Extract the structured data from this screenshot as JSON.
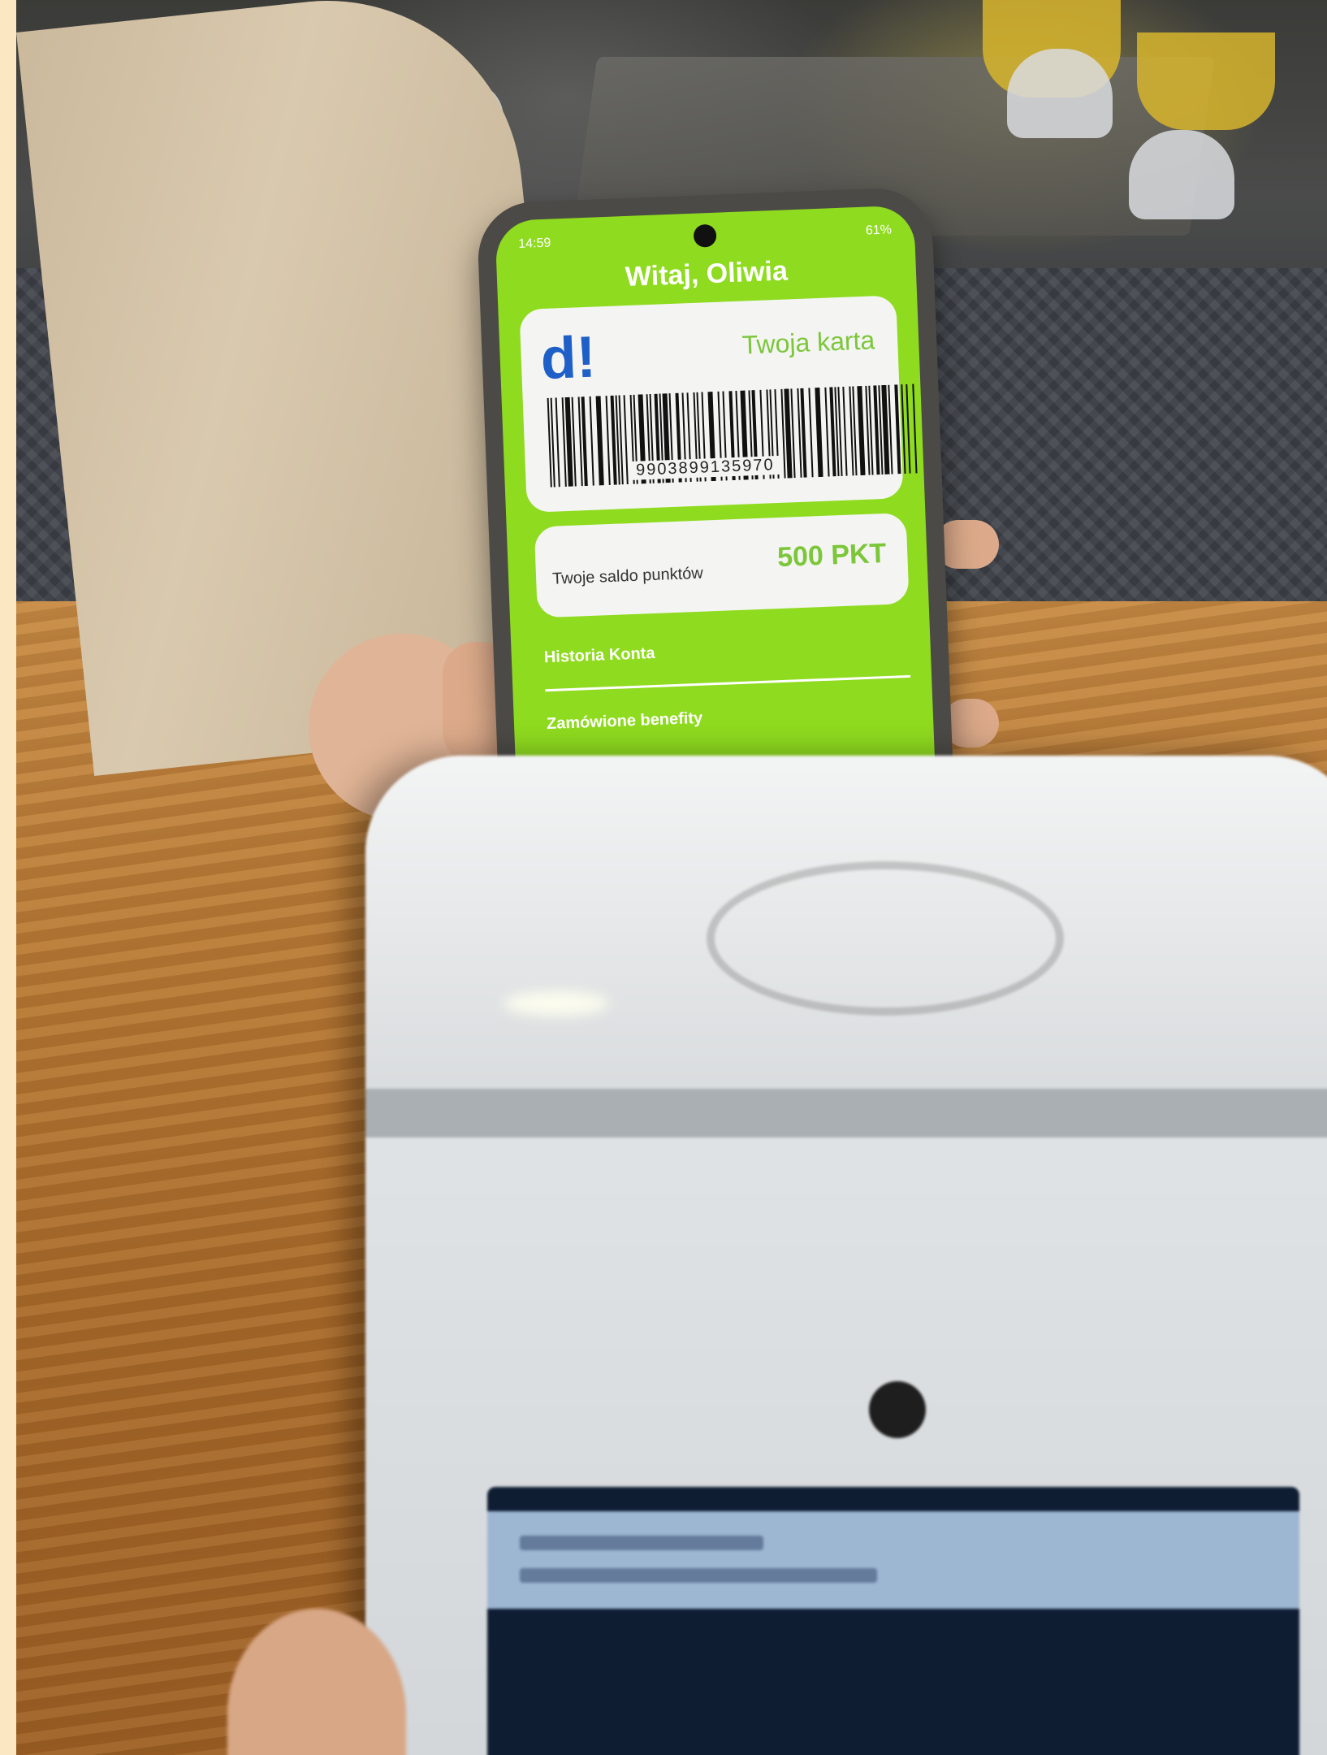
{
  "status_bar": {
    "time": "14:59",
    "battery": "61%"
  },
  "app": {
    "greeting": "Witaj, Oliwia",
    "card": {
      "logo": "d!",
      "title": "Twoja karta",
      "barcode_number": "9903899135970"
    },
    "balance": {
      "label": "Twoje saldo punktów",
      "value": "500 PKT"
    },
    "menu": [
      {
        "label": "Historia Konta"
      },
      {
        "label": "Zamówione benefity"
      }
    ]
  },
  "colors": {
    "screen_green": "#8fdb1f",
    "accent_green": "#7cc63a",
    "logo_blue": "#1e60c8"
  }
}
